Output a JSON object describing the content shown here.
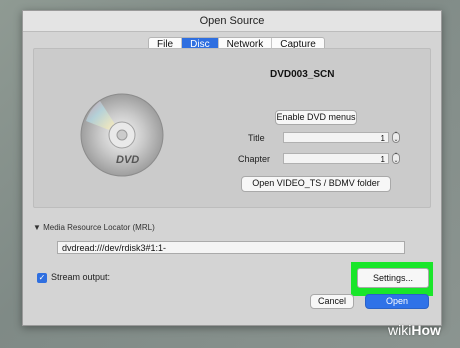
{
  "window": {
    "title": "Open Source"
  },
  "tabs": [
    {
      "label": "File",
      "active": false
    },
    {
      "label": "Disc",
      "active": true
    },
    {
      "label": "Network",
      "active": false
    },
    {
      "label": "Capture",
      "active": false
    }
  ],
  "disc": {
    "name": "DVD003_SCN",
    "enable_menus_label": "Enable DVD menus",
    "title_label": "Title",
    "title_value": "1",
    "chapter_label": "Chapter",
    "chapter_value": "1",
    "open_folder_label": "Open VIDEO_TS / BDMV folder",
    "logo_text": "DVD"
  },
  "mrl": {
    "section_label": "▼ Media Resource Locator (MRL)",
    "value": "dvdread:///dev/rdisk3#1:1-"
  },
  "stream_output": {
    "checked": true,
    "label": "Stream output:",
    "settings_label": "Settings..."
  },
  "footer": {
    "cancel_label": "Cancel",
    "open_label": "Open"
  },
  "watermark": {
    "wiki": "wiki",
    "how": "How"
  },
  "colors": {
    "accent": "#2f6fe0",
    "highlight": "#19e62a"
  }
}
